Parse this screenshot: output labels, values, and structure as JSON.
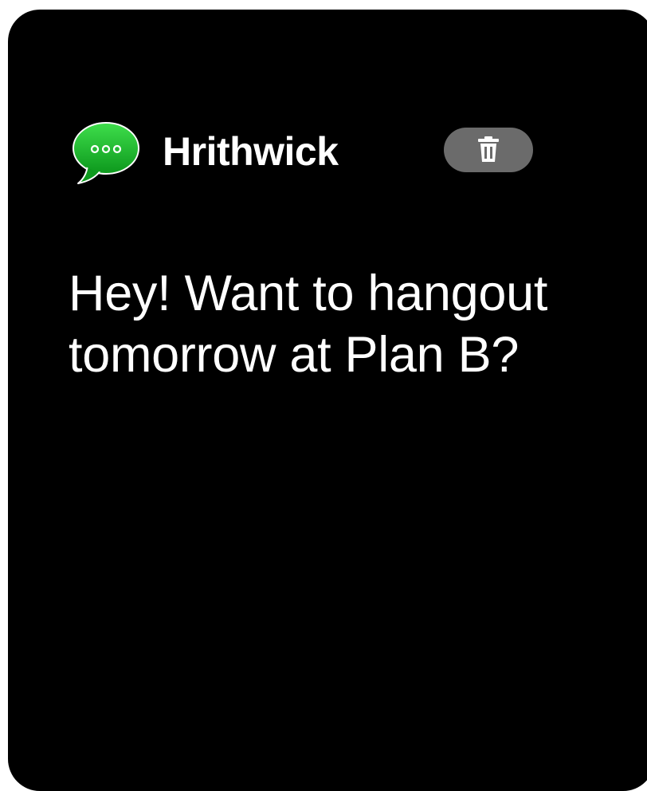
{
  "notification": {
    "app_icon": "messages-bubble-icon",
    "sender": "Hrithwick",
    "message": "Hey! Want to hangout tomorrow at Plan B?",
    "delete_icon": "trash-icon"
  },
  "colors": {
    "background": "#000000",
    "text": "#ffffff",
    "icon_green_top": "#3ddc4a",
    "icon_green_bottom": "#0e9a1e",
    "delete_button": "#6b6b6b"
  }
}
